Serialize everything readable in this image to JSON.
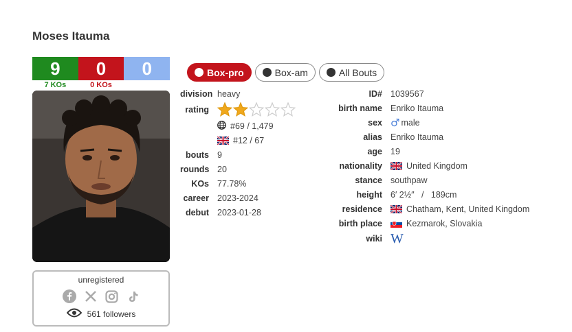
{
  "boxer": {
    "name": "Moses Itauma"
  },
  "record": {
    "wins": "9",
    "losses": "0",
    "draws": "0",
    "ko_wins": "7 KOs",
    "ko_losses": "0 KOs"
  },
  "colors": {
    "win": "#1f8a1f",
    "loss": "#c3141c",
    "draw": "#8fb4f0"
  },
  "tabs": [
    {
      "label": "Box-pro",
      "active": true
    },
    {
      "label": "Box-am",
      "active": false
    },
    {
      "label": "All Bouts",
      "active": false
    }
  ],
  "stats": {
    "division_label": "division",
    "division": "heavy",
    "rating_label": "rating",
    "rating_stars": 2,
    "rating_max": 5,
    "world_rank": "#69 / 1,479",
    "country_rank": "#12 / 67",
    "bouts_label": "bouts",
    "bouts": "9",
    "rounds_label": "rounds",
    "rounds": "20",
    "kos_label": "KOs",
    "kos": "77.78%",
    "career_label": "career",
    "career": "2023-2024",
    "debut_label": "debut",
    "debut": "2023-01-28"
  },
  "bio": {
    "id_label": "ID#",
    "id": "1039567",
    "birth_name_label": "birth name",
    "birth_name": "Enriko Itauma",
    "sex_label": "sex",
    "sex": "male",
    "alias_label": "alias",
    "alias": "Enriko Itauma",
    "age_label": "age",
    "age": "19",
    "nationality_label": "nationality",
    "nationality": "United Kingdom",
    "stance_label": "stance",
    "stance": "southpaw",
    "height_label": "height",
    "height": "6′ 2½″   /   189cm",
    "residence_label": "residence",
    "residence": "Chatham, Kent, United Kingdom",
    "birth_place_label": "birth place",
    "birth_place": "Kezmarok, Slovakia",
    "wiki_label": "wiki"
  },
  "social": {
    "status": "unregistered",
    "followers": "561 followers"
  }
}
